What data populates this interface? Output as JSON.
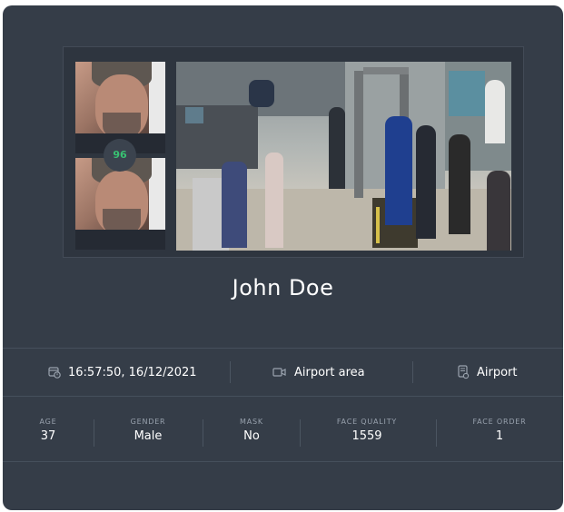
{
  "detection": {
    "match_score": "96",
    "person_name": "John Doe"
  },
  "info": {
    "timestamp": "16:57:50, 16/12/2021",
    "camera": "Airport area",
    "location": "Airport"
  },
  "stats": [
    {
      "label": "AGE",
      "value": "37"
    },
    {
      "label": "GENDER",
      "value": "Male"
    },
    {
      "label": "MASK",
      "value": "No"
    },
    {
      "label": "FACE QUALITY",
      "value": "1559"
    },
    {
      "label": "FACE ORDER",
      "value": "1"
    }
  ],
  "icons": {
    "timestamp": "calendar-clock-icon",
    "camera": "camera-icon",
    "location": "location-pin-icon"
  },
  "colors": {
    "card_bg": "#353d48",
    "score": "#38c172"
  }
}
